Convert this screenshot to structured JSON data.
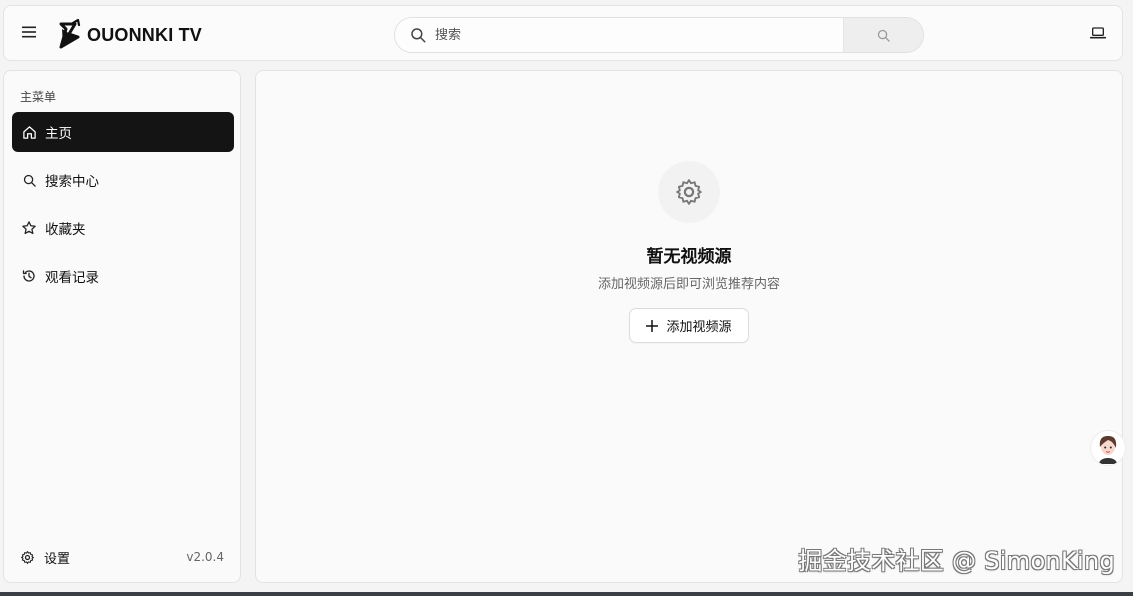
{
  "header": {
    "menu_icon": "hamburger-icon",
    "logo_icon": "cat-play-logo",
    "app_title": "OUONNKI TV",
    "search_placeholder": "搜索",
    "search_icon": "search-icon",
    "submit_icon": "search-icon",
    "device_icon": "laptop-icon"
  },
  "sidebar": {
    "section_label": "主菜单",
    "items": [
      {
        "label": "主页",
        "icon": "home-icon",
        "active": true
      },
      {
        "label": "搜索中心",
        "icon": "search-icon",
        "active": false
      },
      {
        "label": "收藏夹",
        "icon": "star-icon",
        "active": false
      },
      {
        "label": "观看记录",
        "icon": "history-icon",
        "active": false
      }
    ],
    "settings_label": "设置",
    "settings_icon": "gear-icon",
    "version": "v2.0.4"
  },
  "main": {
    "empty_icon": "gear-icon",
    "empty_title": "暂无视频源",
    "empty_subtitle": "添加视频源后即可浏览推荐内容",
    "add_button_label": "添加视频源",
    "add_button_icon": "plus-icon"
  },
  "floating": {
    "avatar_icon": "assistant-avatar"
  },
  "watermark": "掘金技术社区 @ SimonKing",
  "colors": {
    "active_nav_bg": "#141414",
    "active_nav_text": "#ffffff",
    "panel_bg": "#fafafa",
    "border": "#e3e3e3"
  }
}
